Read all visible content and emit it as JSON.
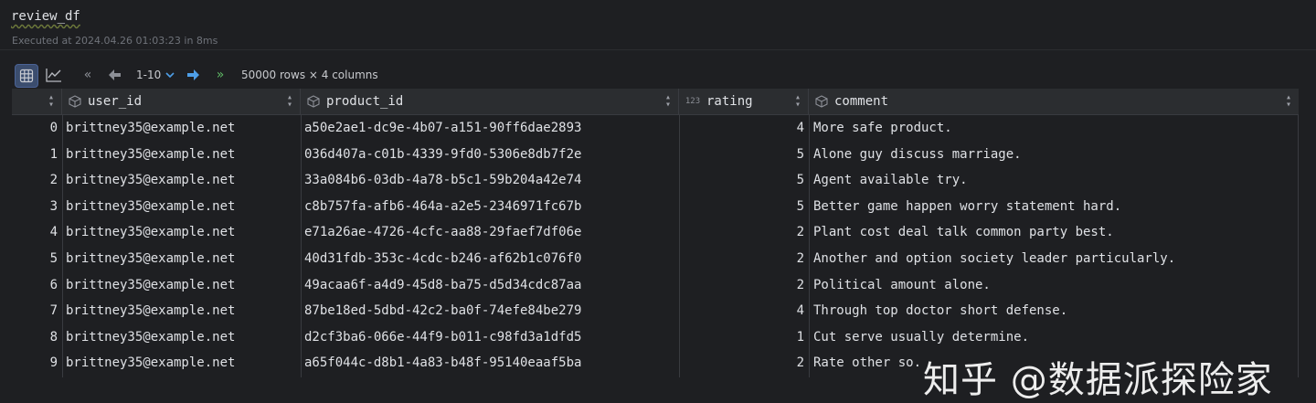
{
  "cell": {
    "code": "review_df",
    "executed": "Executed at 2024.04.26 01:03:23 in 8ms"
  },
  "toolbar": {
    "range": "1-10",
    "rows_info": "50000 rows × 4 columns"
  },
  "columns": [
    {
      "name": "",
      "type_icon": "sort-icon"
    },
    {
      "name": "user_id",
      "type_icon": "cube-icon"
    },
    {
      "name": "product_id",
      "type_icon": "cube-icon"
    },
    {
      "name": "rating",
      "type_icon": "numeric-123-icon"
    },
    {
      "name": "comment",
      "type_icon": "cube-icon"
    }
  ],
  "rows": [
    {
      "index": "0",
      "user_id": "brittney35@example.net",
      "product_id": "a50e2ae1-dc9e-4b07-a151-90ff6dae2893",
      "rating": "4",
      "comment": "More safe product."
    },
    {
      "index": "1",
      "user_id": "brittney35@example.net",
      "product_id": "036d407a-c01b-4339-9fd0-5306e8db7f2e",
      "rating": "5",
      "comment": "Alone guy discuss marriage."
    },
    {
      "index": "2",
      "user_id": "brittney35@example.net",
      "product_id": "33a084b6-03db-4a78-b5c1-59b204a42e74",
      "rating": "5",
      "comment": "Agent available try."
    },
    {
      "index": "3",
      "user_id": "brittney35@example.net",
      "product_id": "c8b757fa-afb6-464a-a2e5-2346971fc67b",
      "rating": "5",
      "comment": "Better game happen worry statement hard."
    },
    {
      "index": "4",
      "user_id": "brittney35@example.net",
      "product_id": "e71a26ae-4726-4cfc-aa88-29faef7df06e",
      "rating": "2",
      "comment": "Plant cost deal talk common party best."
    },
    {
      "index": "5",
      "user_id": "brittney35@example.net",
      "product_id": "40d31fdb-353c-4cdc-b246-af62b1c076f0",
      "rating": "2",
      "comment": "Another and option society leader particularly."
    },
    {
      "index": "6",
      "user_id": "brittney35@example.net",
      "product_id": "49acaa6f-a4d9-45d8-ba75-d5d34cdc87aa",
      "rating": "2",
      "comment": "Political amount alone."
    },
    {
      "index": "7",
      "user_id": "brittney35@example.net",
      "product_id": "87be18ed-5dbd-42c2-ba0f-74efe84be279",
      "rating": "4",
      "comment": "Through top doctor short defense."
    },
    {
      "index": "8",
      "user_id": "brittney35@example.net",
      "product_id": "d2cf3ba6-066e-44f9-b011-c98fd3a1dfd5",
      "rating": "1",
      "comment": "Cut serve usually determine."
    },
    {
      "index": "9",
      "user_id": "brittney35@example.net",
      "product_id": "a65f044c-d8b1-4a83-b48f-95140eaaf5ba",
      "rating": "2",
      "comment": "Rate other so."
    }
  ],
  "watermark": "知乎 @数据派探险家",
  "colors": {
    "accent": "#4a6396",
    "nav_green": "#5fb865",
    "nav_blue": "#4e9fe8"
  }
}
